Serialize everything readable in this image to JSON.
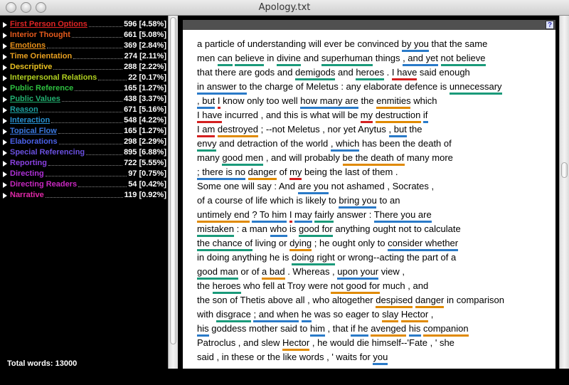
{
  "window": {
    "title": "Apology.txt"
  },
  "colors": {
    "red": "#d42020",
    "orange": "#e08a00",
    "teal": "#1a9a7a",
    "blue": "#2a7ac8"
  },
  "categories": [
    {
      "label": "First Person Options",
      "count": "596 [4.58%]",
      "color": "#e02424",
      "underline": true
    },
    {
      "label": "Interior Thought",
      "count": "661 [5.08%]",
      "color": "#e55a1c",
      "underline": false
    },
    {
      "label": "Emotions",
      "count": "369 [2.84%]",
      "color": "#e8901a",
      "underline": true
    },
    {
      "label": "Time Orientation",
      "count": "274 [2.11%]",
      "color": "#e8a020",
      "underline": false
    },
    {
      "label": "Descriptive",
      "count": "288 [2.22%]",
      "color": "#e8c020",
      "underline": false
    },
    {
      "label": "Interpersonal Relations",
      "count": "22 [0.17%]",
      "color": "#b0d020",
      "underline": false
    },
    {
      "label": "Public Reference",
      "count": "165 [1.27%]",
      "color": "#2ec040",
      "underline": false
    },
    {
      "label": "Public Values",
      "count": "438 [3.37%]",
      "color": "#22b070",
      "underline": true
    },
    {
      "label": "Reason",
      "count": "671 [5.16%]",
      "color": "#1ea0a0",
      "underline": true
    },
    {
      "label": "Interaction",
      "count": "548 [4.22%]",
      "color": "#2890d0",
      "underline": true
    },
    {
      "label": "Topical Flow",
      "count": "165 [1.27%]",
      "color": "#3a78e0",
      "underline": true
    },
    {
      "label": "Elaborations",
      "count": "298 [2.29%]",
      "color": "#4a60e8",
      "underline": false
    },
    {
      "label": "Special Referencing",
      "count": "895 [6.88%]",
      "color": "#6a50e0",
      "underline": false
    },
    {
      "label": "Reporting",
      "count": "722 [5.55%]",
      "color": "#8a40e0",
      "underline": false
    },
    {
      "label": "Directing",
      "count": "97 [0.75%]",
      "color": "#b030d8",
      "underline": false
    },
    {
      "label": "Directing Readers",
      "count": "54 [0.42%]",
      "color": "#c828c0",
      "underline": false
    },
    {
      "label": "Narrative",
      "count": "119 [0.92%]",
      "color": "#e028a8",
      "underline": false
    }
  ],
  "total_words": "Total words: 13000",
  "help_label": "?",
  "text_lines": [
    "a particle of understanding will ever be convinced by you that the same",
    "men can believe in divine and superhuman things , and yet not believe",
    "that there are gods and demigods and heroes . I have said enough",
    "in answer to the charge of Meletus : any elaborate defence is unnecessary",
    ", but I know only too well how many are the enmities which",
    "I have incurred , and this is what will be my destruction if",
    "I am destroyed ; --not Meletus , nor yet Anytus , but the",
    "envy and detraction of the world , which has been the death of",
    "many good men , and will probably be the death of many more",
    "; there is no danger of my being the last of them .",
    "Some one will say : And are you not ashamed , Socrates ,",
    "of a course of life which is likely to bring you to an",
    "untimely end ? To him I may fairly answer : There you are",
    "mistaken : a man who is good for anything ought not to calculate",
    "the chance of living or dying ; he ought only to consider whether",
    "in doing anything he is doing right or wrong--acting the part of a",
    "good man or of a bad . Whereas , upon your view ,",
    "the heroes who fell at Troy were not good for much , and",
    "the son of Thetis above all , who altogether despised danger in comparison",
    "with disgrace ; and when he was so eager to slay Hector ,",
    "his goddess mother said to him , that if he avenged his companion",
    "Patroclus , and slew Hector , he would die himself--'Fate , ' she",
    "said , in these or the like words , ' waits for you"
  ]
}
